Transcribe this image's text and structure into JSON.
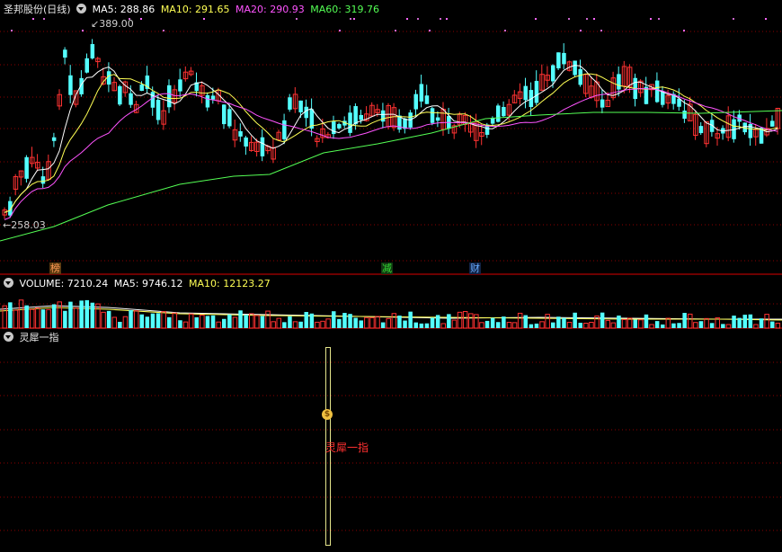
{
  "panels": {
    "main": {
      "stock_name": "圣邦股份(日线)",
      "ma_legend": [
        {
          "label": "MA5: 288.86",
          "color": "#ffffff"
        },
        {
          "label": "MA10: 291.65",
          "color": "#ffff54"
        },
        {
          "label": "MA20: 290.93",
          "color": "#ff54ff"
        },
        {
          "label": "MA60: 319.76",
          "color": "#54ff54"
        }
      ],
      "high_label": "389.00",
      "low_label": "258.03",
      "event_markers": [
        {
          "text": "榜",
          "color": "#ff9955",
          "bg": "#5a3a10"
        },
        {
          "text": "减",
          "color": "#33dd33",
          "bg": "#123a12"
        },
        {
          "text": "财",
          "color": "#66aaff",
          "bg": "#122244"
        }
      ]
    },
    "volume": {
      "legend": [
        {
          "label": "VOLUME: 7210.24",
          "color": "#ffffff"
        },
        {
          "label": "MA5: 9746.12",
          "color": "#ffffff"
        },
        {
          "label": "MA10: 12123.27",
          "color": "#ffff54"
        }
      ]
    },
    "indicator": {
      "title": "灵犀一指",
      "bar_label": "灵犀一指",
      "coin_glyph": "$"
    }
  },
  "chart_data": {
    "type": "candlestick",
    "y_range": [
      258.03,
      389.0
    ],
    "high": 389.0,
    "low": 258.03,
    "grid": true,
    "ma_last": {
      "MA5": 288.86,
      "MA10": 291.65,
      "MA20": 290.93,
      "MA60": 319.76
    },
    "volume_last": 7210.24,
    "volume_ma_last": {
      "MA5": 9746.12,
      "MA10": 12123.27
    }
  },
  "colors": {
    "up": "#ff3232",
    "down": "#54ffff",
    "grid": "#8b0000",
    "separator": "#b00000",
    "signal_bar": "#e6e68c"
  }
}
